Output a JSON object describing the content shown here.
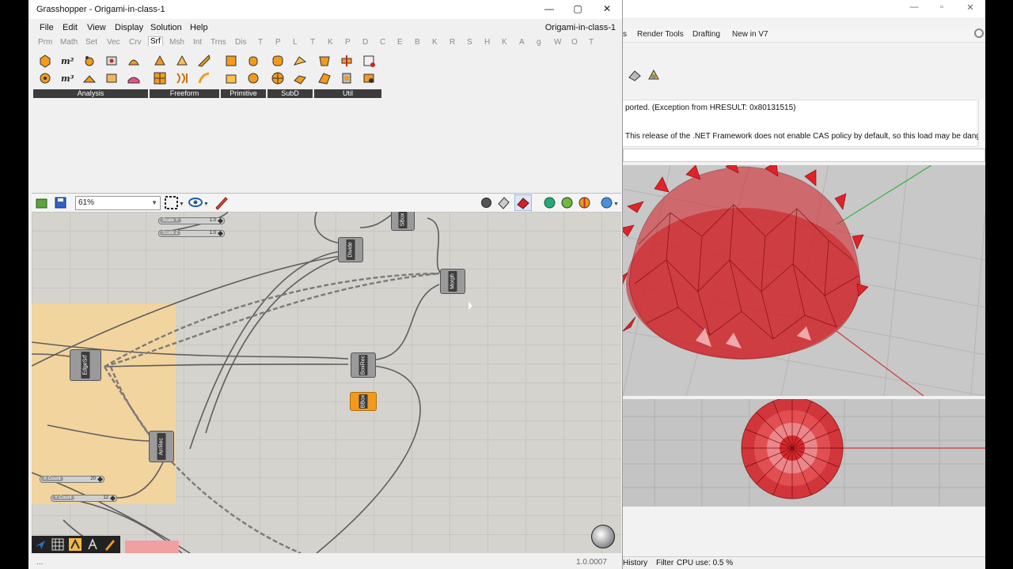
{
  "rhino": {
    "tabs": [
      "s",
      "Render Tools",
      "Drafting",
      "New in V7"
    ],
    "command_lines": [
      "ported. (Exception from HRESULT: 0x80131515)",
      "This release of the .NET Framework does not enable CAS policy by default, so this load may be dangerous."
    ],
    "status": [
      "History",
      "Filter",
      "CPU use: 0.5 %"
    ]
  },
  "grasshopper": {
    "title": "Grasshopper - Origami-in-class-1",
    "doc_title": "Origami-in-class-1",
    "menus": [
      "File",
      "Edit",
      "View",
      "Display",
      "Solution",
      "Help"
    ],
    "categories": [
      "Prm",
      "Math",
      "Set",
      "Vec",
      "Crv",
      "Srf",
      "Msh",
      "Int",
      "Trns",
      "Dis",
      "T",
      "P",
      "L",
      "T",
      "K",
      "P",
      "D",
      "C",
      "E",
      "B",
      "K",
      "R",
      "S",
      "H",
      "K",
      "A",
      "g",
      "W",
      "O",
      "T"
    ],
    "active_category": "Srf",
    "panels": [
      "Analysis",
      "Freeform",
      "Primitive",
      "SubD",
      "Util"
    ],
    "zoom": "61%",
    "components": {
      "divide": "Divide",
      "morph": "Morph",
      "edgesrf": "EdgeSrf",
      "boxrec": "BoxRec",
      "bbox": "BBox",
      "arrrec": "ArrRec",
      "sbox": "SBox"
    },
    "sliders": {
      "scale_y": {
        "label": "Scale Y",
        "value": "1.0"
      },
      "scale_z": {
        "label": "Scale Z",
        "value": "1.0"
      },
      "x_count": {
        "label": "X Count",
        "value": "20"
      },
      "y_count": {
        "label": "Y Count",
        "value": "12"
      }
    },
    "status_left": "...",
    "version": "1.0.0007"
  }
}
